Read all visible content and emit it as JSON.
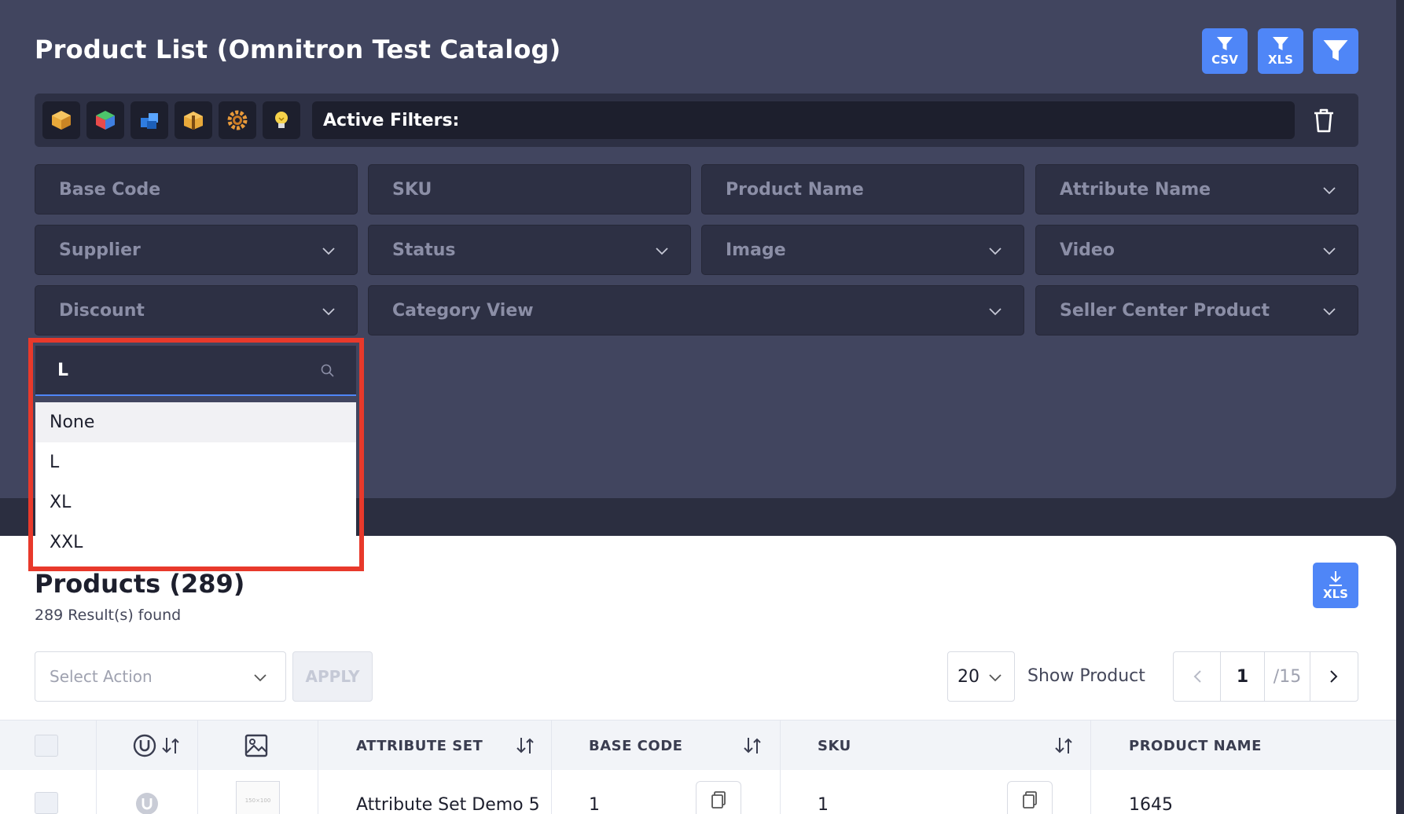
{
  "header": {
    "title": "Product List (Omnitron Test Catalog)",
    "export_csv_label": "CSV",
    "export_xls_label": "XLS"
  },
  "toolbar": {
    "icons": [
      "product-box-icon",
      "color-cube-icon",
      "blue-cubes-icon",
      "package-icon",
      "gear-icon",
      "lightbulb-icon"
    ],
    "active_filters_label": "Active Filters:"
  },
  "filters": {
    "base_code": "Base Code",
    "sku": "SKU",
    "product_name": "Product Name",
    "attribute_name": "Attribute Name",
    "supplier": "Supplier",
    "status": "Status",
    "image": "Image",
    "video": "Video",
    "discount": "Discount",
    "category_view": "Category View",
    "seller_center_product": "Seller Center Product"
  },
  "dropdown": {
    "search_value": "L",
    "options": [
      "None",
      "L",
      "XL",
      "XXL"
    ]
  },
  "products": {
    "title": "Products (289)",
    "results_found": "289 Result(s) found",
    "xls_label": "XLS",
    "select_action_placeholder": "Select Action",
    "apply_label": "APPLY",
    "page_size": "20",
    "show_product_label": "Show Product",
    "current_page": "1",
    "total_pages": "/15"
  },
  "table": {
    "headers": {
      "attribute_set": "ATTRIBUTE SET",
      "base_code": "BASE CODE",
      "sku": "SKU",
      "product_name": "PRODUCT NAME"
    },
    "rows": [
      {
        "thumb": "150×100",
        "attribute_set": "Attribute Set Demo 5",
        "base_code": "1",
        "sku": "1",
        "product_name": "1645"
      }
    ]
  },
  "colors": {
    "accent": "#4f86f7",
    "highlight": "#e8392b",
    "panel_bg": "#41455f",
    "field_bg": "#2d3044"
  }
}
